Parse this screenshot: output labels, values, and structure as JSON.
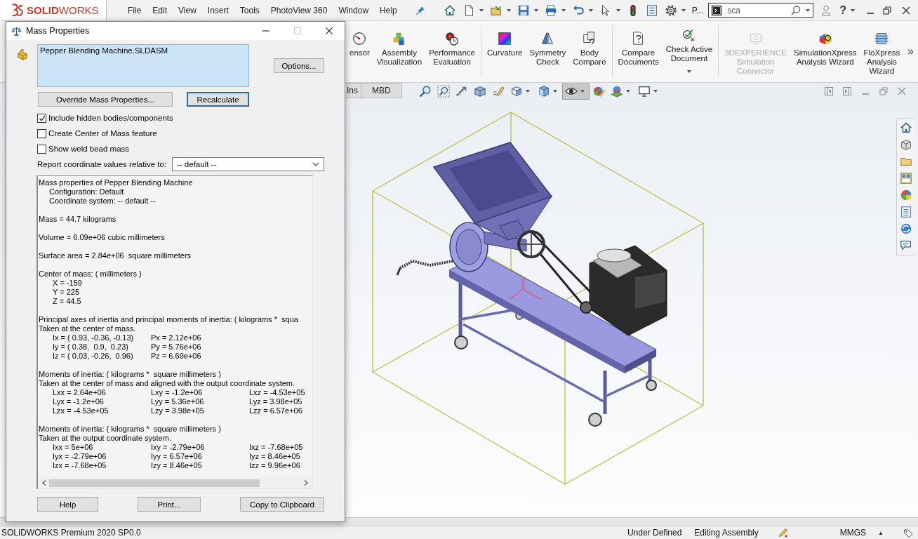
{
  "app_bar": {
    "logo": "**SOLID**WORKS",
    "menu": [
      "File",
      "Edit",
      "View",
      "Insert",
      "Tools",
      "PhotoView 360",
      "Window",
      "Help"
    ],
    "quick_label": "P...",
    "search": {
      "value": "sca"
    },
    "help_glyph": "?"
  },
  "ribbon": {
    "groups": [
      {
        "items": [
          {
            "label": [
              "ensor"
            ],
            "disabled": false,
            "dropdown": false
          },
          {
            "label": [
              "Assembly",
              "Visualization"
            ],
            "disabled": false,
            "dropdown": false
          },
          {
            "label": [
              "Performance",
              "Evaluation"
            ],
            "disabled": false,
            "dropdown": false
          }
        ]
      },
      {
        "items": [
          {
            "label": [
              "Curvature"
            ],
            "disabled": false,
            "dropdown": false
          },
          {
            "label": [
              "Symmetry",
              "Check"
            ],
            "disabled": false,
            "dropdown": false
          },
          {
            "label": [
              "Body",
              "Compare"
            ],
            "disabled": false,
            "dropdown": false
          }
        ]
      },
      {
        "items": [
          {
            "label": [
              "Compare",
              "Documents"
            ],
            "disabled": false,
            "dropdown": false
          },
          {
            "label": [
              "Check Active",
              "Document"
            ],
            "disabled": false,
            "dropdown": true
          }
        ]
      },
      {
        "items": [
          {
            "label": [
              "3DEXPERIENCE",
              "Simulation",
              "Connector"
            ],
            "disabled": true,
            "dropdown": false
          },
          {
            "label": [
              "SimulationXpress",
              "Analysis Wizard"
            ],
            "disabled": false,
            "dropdown": false
          },
          {
            "label": [
              "FloXpress",
              "Analysis",
              "Wizard"
            ],
            "disabled": false,
            "dropdown": false
          }
        ]
      }
    ],
    "more": "»"
  },
  "command_tabs": [
    {
      "label": "Ins",
      "selected": false
    },
    {
      "label": "MBD",
      "selected": false
    }
  ],
  "view_toolbar": {
    "tools": [
      {
        "pressed": false,
        "dropdown": false
      },
      {
        "pressed": false,
        "dropdown": false
      },
      {
        "pressed": false,
        "dropdown": false
      },
      {
        "pressed": false,
        "dropdown": false
      },
      {
        "pressed": false,
        "dropdown": false
      },
      {
        "pressed": false,
        "dropdown": true
      },
      {
        "pressed": false,
        "dropdown": true
      },
      {
        "pressed": true,
        "dropdown": true
      },
      {
        "pressed": false,
        "dropdown": false
      },
      {
        "pressed": false,
        "dropdown": true
      },
      {
        "pressed": false,
        "dropdown": true
      }
    ]
  },
  "dialog": {
    "title": "Mass Properties",
    "maximize": {
      "disabled": true
    },
    "selection": [
      "Pepper Blending Machine.SLDASM"
    ],
    "options_button": "Options...",
    "buttons": [
      {
        "label": "Override Mass Properties...",
        "default": false
      },
      {
        "label": "Recalculate",
        "default": true
      }
    ],
    "checkboxes": [
      {
        "label": "Include hidden bodies/components",
        "checked": true
      },
      {
        "label": "Create Center of Mass feature",
        "checked": false
      },
      {
        "label": "Show weld bead mass",
        "checked": false
      }
    ],
    "coordinates": {
      "label": "Report coordinate values relative to:",
      "value": "-- default --"
    },
    "report": {
      "sections": [
        {
          "lines": [
            "Mass properties of Pepper Blending Machine"
          ],
          "details": [
            "Configuration: Default",
            "Coordinate system: -- default --"
          ]
        },
        {
          "lines": [
            "Mass = 44.7 kilograms"
          ]
        },
        {
          "lines": [
            "Volume = 6.09e+06 cubic millimeters"
          ]
        },
        {
          "lines": [
            "Surface area = 2.84e+06  square millimeters"
          ]
        },
        {
          "lines": [
            "Center of mass: ( millimeters )"
          ],
          "rows": [
            [
              "X = -159"
            ],
            [
              "Y = 225"
            ],
            [
              "Z = 44.5"
            ]
          ]
        },
        {
          "lines": [
            "Principal axes of inertia and principal moments of inertia: ( kilograms *  squa",
            "Taken at the center of mass."
          ],
          "rows": [
            [
              "Ix = ( 0.93, -0.36, -0.13)",
              "Px = 2.12e+06"
            ],
            [
              "Iy = ( 0.38,  0.9,  0.23)",
              "Py = 5.76e+06"
            ],
            [
              "Iz = ( 0.03, -0.26,  0.96)",
              "Pz = 6.69e+06"
            ]
          ]
        },
        {
          "lines": [
            "Moments of inertia: ( kilograms *  square millimeters )",
            "Taken at the center of mass and aligned with the output coordinate system."
          ],
          "rows": [
            [
              "Lxx = 2.64e+06",
              "Lxy = -1.2e+06",
              "Lxz = -4.53e+05"
            ],
            [
              "Lyx = -1.2e+06",
              "Lyy = 5.36e+06",
              "Lyz = 3.98e+05"
            ],
            [
              "Lzx = -4.53e+05",
              "Lzy = 3.98e+05",
              "Lzz = 6.57e+06"
            ]
          ]
        },
        {
          "lines": [
            "Moments of inertia: ( kilograms *  square millimeters )",
            "Taken at the output coordinate system."
          ],
          "rows": [
            [
              "Ixx = 5e+06",
              "Ixy = -2.79e+06",
              "Ixz = -7.68e+05"
            ],
            [
              "Iyx = -2.79e+06",
              "Iyy = 6.57e+06",
              "Iyz = 8.46e+05"
            ],
            [
              "Izx = -7.68e+05",
              "Izy = 8.46e+05",
              "Izz = 9.96e+06"
            ]
          ]
        }
      ]
    },
    "footer_buttons": [
      "Help",
      "Print...",
      "Copy to Clipboard"
    ]
  },
  "status_bar": {
    "product": "SOLIDWORKS Premium 2020 SP0.0",
    "state": "Under Defined",
    "mode": "Editing Assembly",
    "units": "MMGS",
    "units_caret": "▲"
  }
}
